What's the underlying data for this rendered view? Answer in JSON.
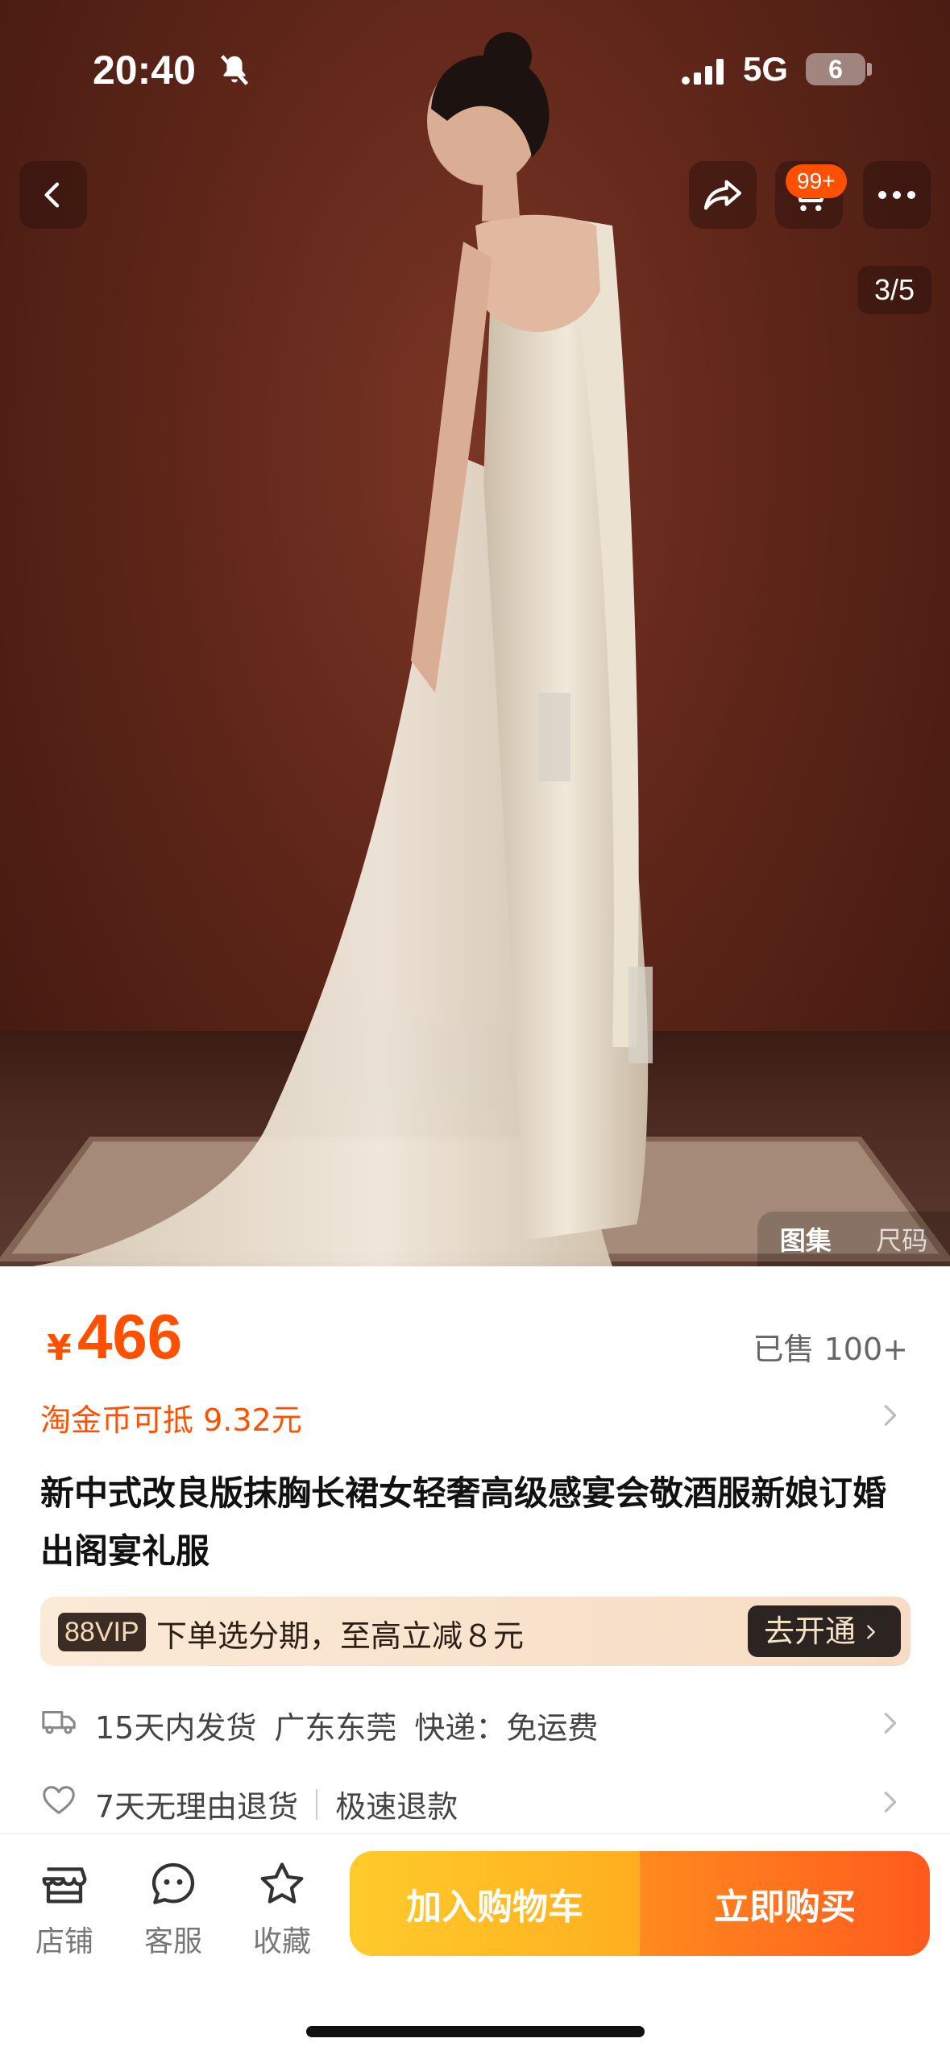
{
  "status_bar": {
    "time": "20:40",
    "network": "5G",
    "battery": "6"
  },
  "header": {
    "cart_badge": "99+",
    "image_counter": "3/5"
  },
  "gallery_tabs": [
    "图集",
    "尺码"
  ],
  "price": {
    "symbol": "¥",
    "value": "466"
  },
  "sold": "已售 100+",
  "coin_deduction": "淘金币可抵 9.32元",
  "product_title": "新中式改良版抹胸长裙女轻奢高级感宴会敬酒服新娘订婚出阁宴礼服",
  "vip": {
    "tag": "88VIP",
    "text": "下单选分期，至高立减８元",
    "button": "去开通"
  },
  "shipping": {
    "items": [
      "15天内发货",
      "广东东莞",
      "快递：免运费"
    ]
  },
  "returns": {
    "items": [
      "7天无理由退货",
      "极速退款"
    ]
  },
  "bottom_nav": {
    "store": "店铺",
    "service": "客服",
    "favorite": "收藏"
  },
  "actions": {
    "add_to_cart": "加入购物车",
    "buy_now": "立即购买"
  },
  "colors": {
    "accent": "#ff5000",
    "cart_btn": "#ffb61f",
    "buy_btn": "#ff6a1c"
  }
}
